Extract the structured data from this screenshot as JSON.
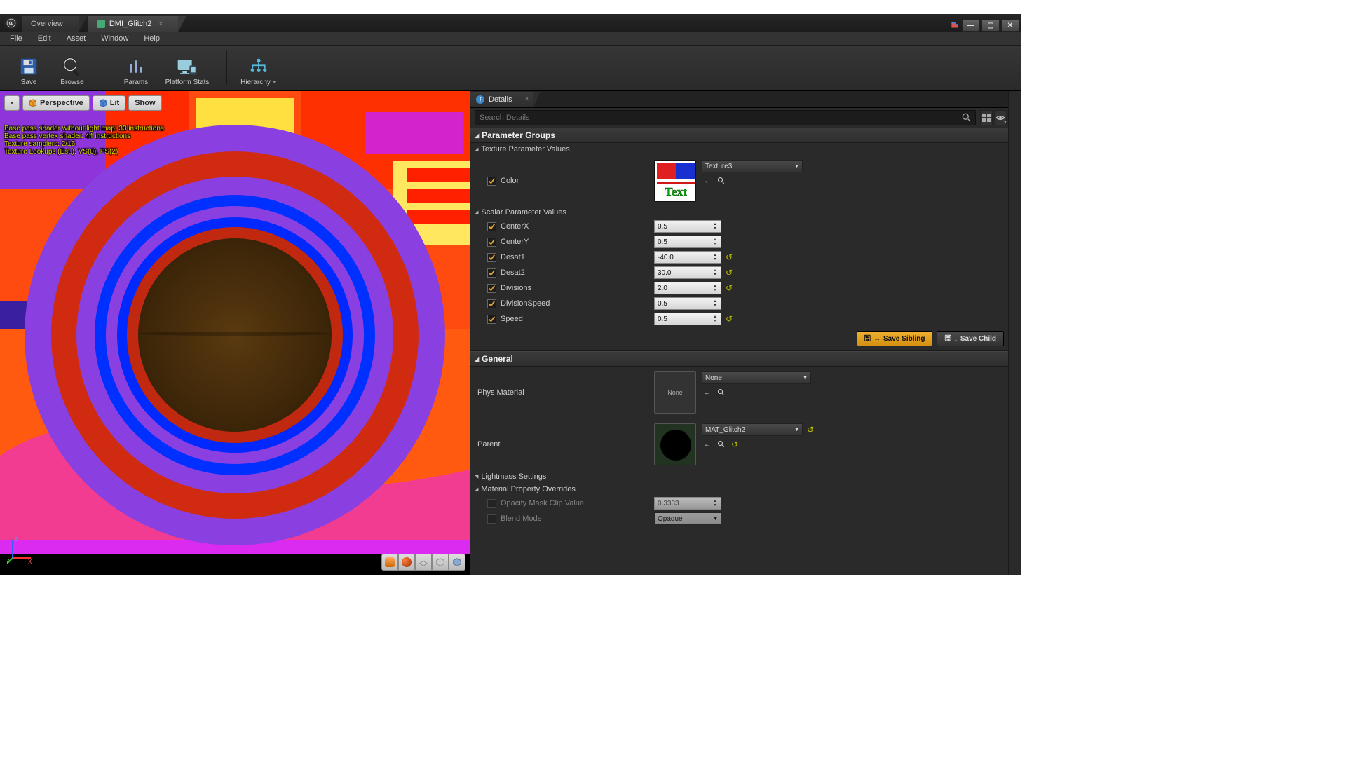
{
  "tabs": {
    "overview": "Overview",
    "activeDoc": "DMI_Glitch2"
  },
  "menu": {
    "file": "File",
    "edit": "Edit",
    "asset": "Asset",
    "window": "Window",
    "help": "Help"
  },
  "toolbar": {
    "save": "Save",
    "browse": "Browse",
    "params": "Params",
    "platformStats": "Platform Stats",
    "hierarchy": "Hierarchy"
  },
  "viewport": {
    "perspective": "Perspective",
    "lit": "Lit",
    "show": "Show",
    "stats": [
      "Base pass shader without light map: 33 instructions",
      "Base pass vertex shader: 44 instructions",
      "Texture samplers: 2/16",
      "Texture Lookups (Est.): VS(0), PS(2)"
    ],
    "axis": {
      "x": "X",
      "y": "Y",
      "z": "Z"
    }
  },
  "details": {
    "tabLabel": "Details",
    "searchPlaceholder": "Search Details",
    "sections": {
      "paramGroups": "Parameter Groups",
      "general": "General"
    },
    "texParamValues": "Texture Parameter Values",
    "texParams": {
      "color": {
        "label": "Color",
        "asset": "Texture3",
        "thumbText": "Text"
      }
    },
    "scalarParamValues": "Scalar Parameter Values",
    "scalars": {
      "centerX": {
        "label": "CenterX",
        "value": "0.5",
        "reset": false
      },
      "centerY": {
        "label": "CenterY",
        "value": "0.5",
        "reset": false
      },
      "desat1": {
        "label": "Desat1",
        "value": "-40.0",
        "reset": true
      },
      "desat2": {
        "label": "Desat2",
        "value": "30.0",
        "reset": true
      },
      "divisions": {
        "label": "Divisions",
        "value": "2.0",
        "reset": true
      },
      "divisionSpeed": {
        "label": "DivisionSpeed",
        "value": "0.5",
        "reset": false
      },
      "speed": {
        "label": "Speed",
        "value": "0.5",
        "reset": true
      }
    },
    "save": {
      "sibling": "Save Sibling",
      "child": "Save Child"
    },
    "general": {
      "physMaterial": {
        "label": "Phys Material",
        "value": "None",
        "thumbLabel": "None"
      },
      "parent": {
        "label": "Parent",
        "value": "MAT_Glitch2"
      },
      "lightmass": "Lightmass Settings",
      "mpo": "Material Property Overrides",
      "opacityMask": {
        "label": "Opacity Mask Clip Value",
        "value": "0.3333"
      },
      "blendMode": {
        "label": "Blend Mode",
        "value": "Opaque"
      }
    }
  }
}
